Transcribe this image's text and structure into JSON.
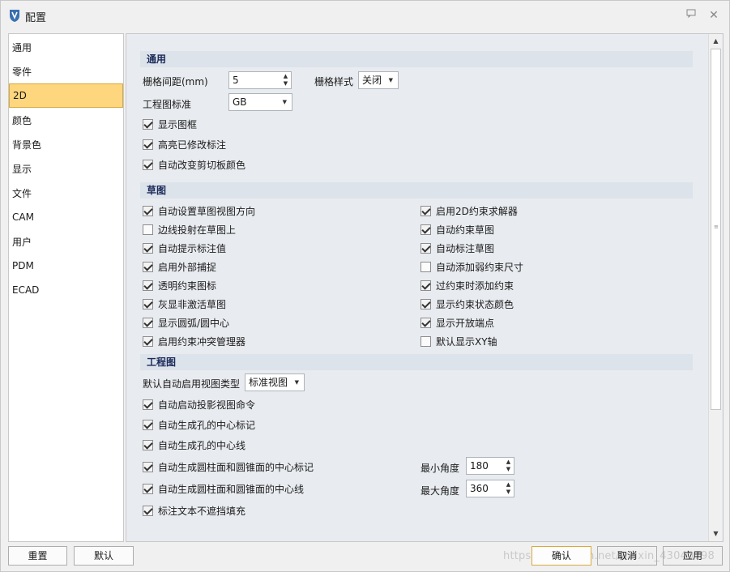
{
  "window": {
    "title": "配置"
  },
  "nav": {
    "items": [
      {
        "label": "通用"
      },
      {
        "label": "零件"
      },
      {
        "label": "2D",
        "active": true
      },
      {
        "label": "颜色"
      },
      {
        "label": "背景色"
      },
      {
        "label": "显示"
      },
      {
        "label": "文件"
      },
      {
        "label": "CAM"
      },
      {
        "label": "用户"
      },
      {
        "label": "PDM"
      },
      {
        "label": "ECAD"
      }
    ]
  },
  "general": {
    "heading": "通用",
    "grid_spacing_label": "栅格间距(mm)",
    "grid_spacing_value": "5",
    "grid_style_label": "栅格样式",
    "grid_style_value": "关闭",
    "drawing_standard_label": "工程图标准",
    "drawing_standard_value": "GB",
    "checks": [
      {
        "label": "显示图框",
        "checked": true
      },
      {
        "label": "高亮已修改标注",
        "checked": true
      },
      {
        "label": "自动改变剪切板颜色",
        "checked": true
      }
    ]
  },
  "sketch": {
    "heading": "草图",
    "left": [
      {
        "label": "自动设置草图视图方向",
        "checked": true
      },
      {
        "label": "边线投射在草图上",
        "checked": false
      },
      {
        "label": "自动提示标注值",
        "checked": true
      },
      {
        "label": "启用外部捕捉",
        "checked": true
      },
      {
        "label": "透明约束图标",
        "checked": true
      },
      {
        "label": "灰显非激活草图",
        "checked": true
      },
      {
        "label": "显示圆弧/圆中心",
        "checked": true
      },
      {
        "label": "启用约束冲突管理器",
        "checked": true
      }
    ],
    "right": [
      {
        "label": "启用2D约束求解器",
        "checked": true
      },
      {
        "label": "自动约束草图",
        "checked": true
      },
      {
        "label": "自动标注草图",
        "checked": true
      },
      {
        "label": "自动添加弱约束尺寸",
        "checked": false
      },
      {
        "label": "过约束时添加约束",
        "checked": true
      },
      {
        "label": "显示约束状态颜色",
        "checked": true
      },
      {
        "label": "显示开放端点",
        "checked": true
      },
      {
        "label": "默认显示XY轴",
        "checked": false
      }
    ]
  },
  "drawing": {
    "heading": "工程图",
    "view_type_label": "默认自动启用视图类型",
    "view_type_value": "标准视图",
    "checks": [
      {
        "label": "自动启动投影视图命令",
        "checked": true
      },
      {
        "label": "自动生成孔的中心标记",
        "checked": true
      },
      {
        "label": "自动生成孔的中心线",
        "checked": true
      },
      {
        "label": "自动生成圆柱面和圆锥面的中心标记",
        "checked": true
      },
      {
        "label": "自动生成圆柱面和圆锥面的中心线",
        "checked": true
      },
      {
        "label": "标注文本不遮挡填充",
        "checked": true
      }
    ],
    "min_angle_label": "最小角度",
    "min_angle_value": "180",
    "max_angle_label": "最大角度",
    "max_angle_value": "360"
  },
  "footer": {
    "reset_label": "重置",
    "default_label": "默认",
    "ok_label": "确认",
    "cancel_label": "取消",
    "apply_label": "应用",
    "watermark": "https://blog.csdn.net/weixin_43040798"
  },
  "colors": {
    "nav_active_bg": "#fdd67d",
    "section_text": "#1a2a5a",
    "panel_bg": "#e8ebef"
  }
}
